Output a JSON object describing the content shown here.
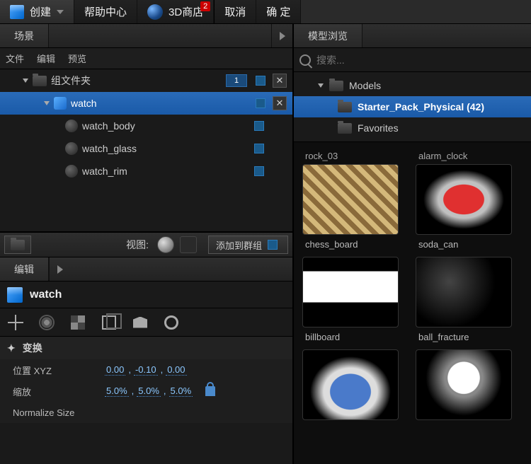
{
  "top": {
    "create": "创建",
    "help": "帮助中心",
    "store": "3D商店",
    "store_badge": "2",
    "cancel": "取消",
    "ok": "确 定"
  },
  "left": {
    "scene_tab": "场景",
    "menu_file": "文件",
    "menu_edit": "编辑",
    "menu_preview": "预览",
    "group_folder": "组文件夹",
    "group_count": "1",
    "obj_watch": "watch",
    "obj_body": "watch_body",
    "obj_glass": "watch_glass",
    "obj_rim": "watch_rim",
    "view_label": "视图:",
    "add_to_group": "添加到群组",
    "edit_tab": "编辑",
    "obj_title": "watch",
    "transform_hdr": "变换",
    "pos_label": "位置 XYZ",
    "pos": [
      "0.00",
      "-0.10",
      "0.00"
    ],
    "scale_label": "缩放",
    "scale": [
      "5.0%",
      "5.0%",
      "5.0%"
    ],
    "norm_label": "Normalize Size"
  },
  "right": {
    "browser_tab": "模型浏览",
    "search_placeholder": "搜索...",
    "models": "Models",
    "pack": "Starter_Pack_Physical (42)",
    "fav": "Favorites",
    "a1": "rock_03",
    "a2": "alarm_clock",
    "a3": "chess_board",
    "a4": "soda_can",
    "a5": "billboard",
    "a6": "ball_fracture"
  }
}
